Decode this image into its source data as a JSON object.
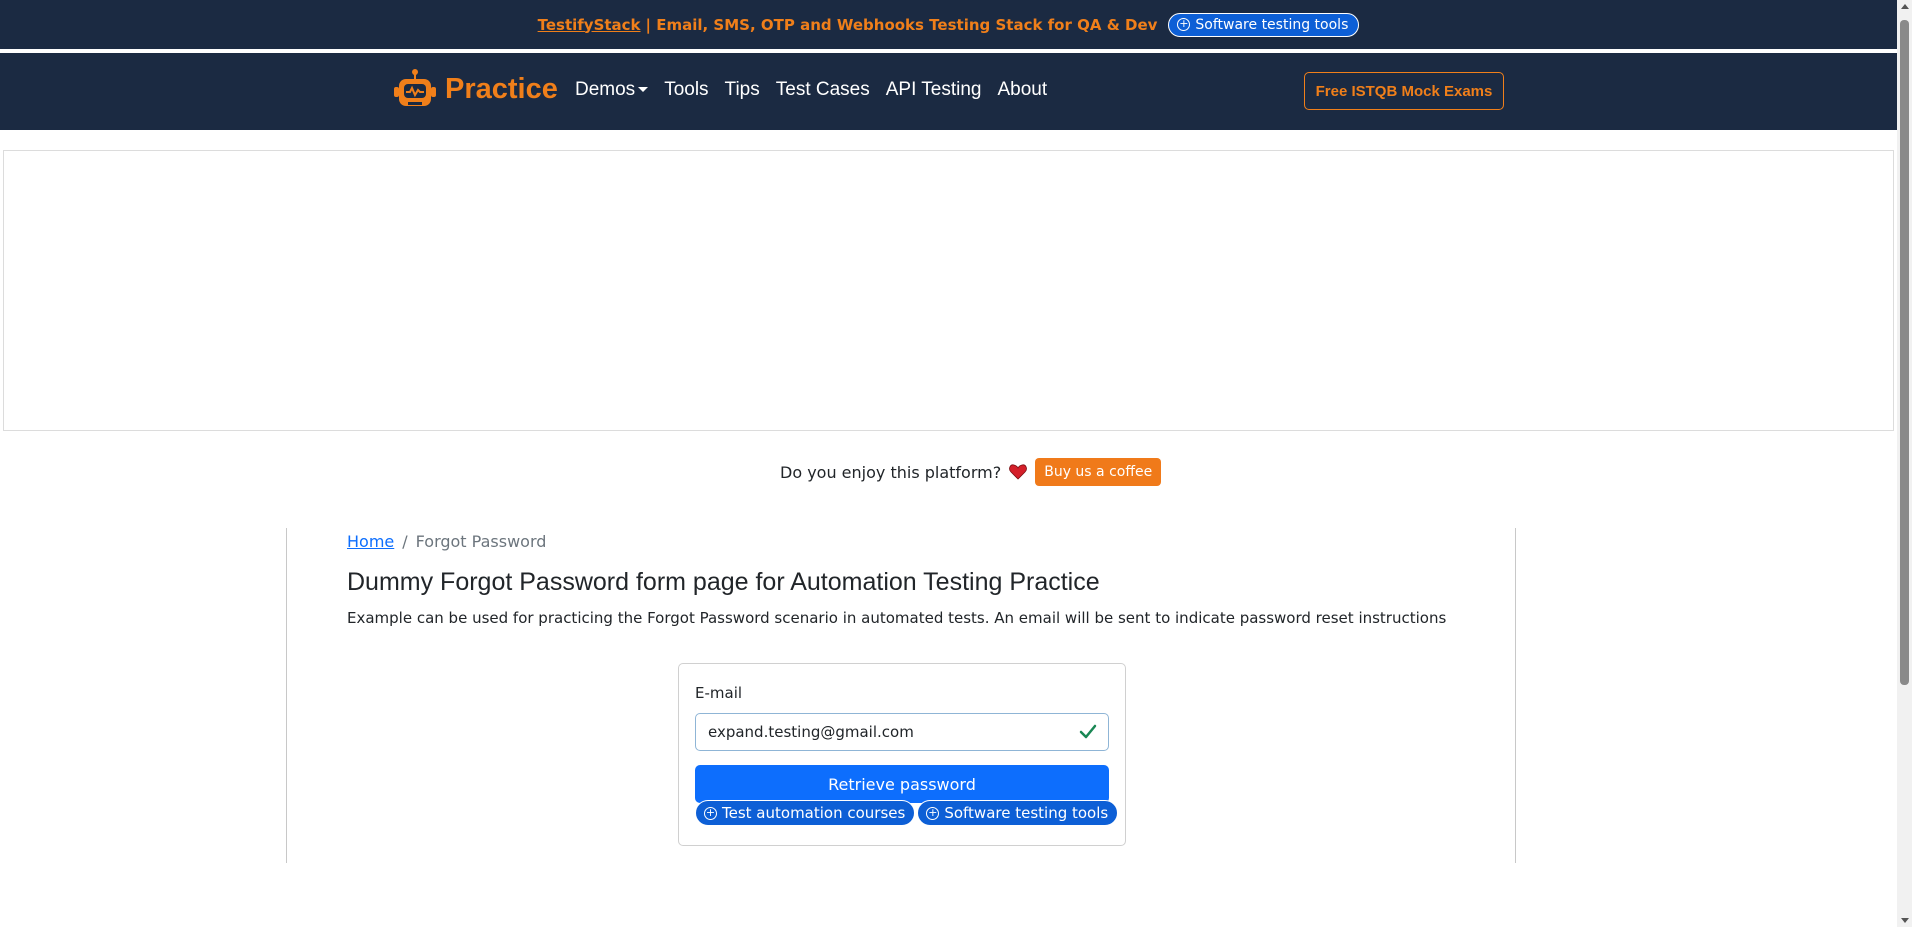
{
  "promo": {
    "brand": "TestifyStack",
    "text": "| Email, SMS, OTP and Webhooks Testing Stack for QA & Dev",
    "pill_label": "Software testing tools"
  },
  "nav": {
    "brand": "Practice",
    "links": [
      "Demos",
      "Tools",
      "Tips",
      "Test Cases",
      "API Testing",
      "About"
    ],
    "cta": "Free ISTQB Mock Exams"
  },
  "support": {
    "text": "Do you enjoy this platform?",
    "button": "Buy us a coffee"
  },
  "breadcrumb": {
    "home": "Home",
    "separator": "/",
    "current": "Forgot Password"
  },
  "page": {
    "title": "Dummy Forgot Password form page for Automation Testing Practice",
    "description": "Example can be used for practicing the Forgot Password scenario in automated tests. An email will be sent to indicate password reset instructions"
  },
  "form": {
    "email_label": "E-mail",
    "email_value": "expand.testing@gmail.com",
    "submit_label": "Retrieve password",
    "chips": [
      "Test automation courses",
      "Software testing tools"
    ]
  },
  "colors": {
    "navy": "#1b2a42",
    "orange": "#f07f1a",
    "primary": "#0d6efd"
  }
}
